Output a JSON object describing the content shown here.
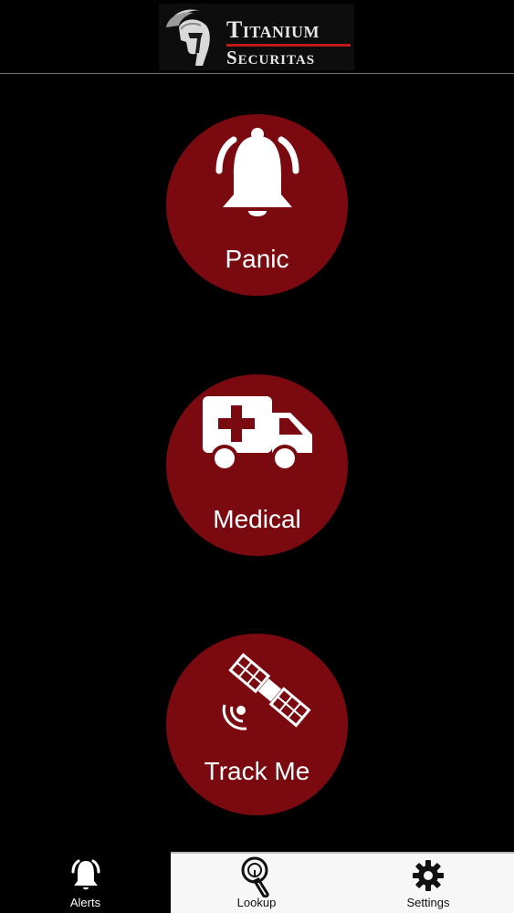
{
  "header": {
    "logo_line1": "Titanium",
    "logo_line2": "Securitas"
  },
  "alerts": {
    "panic_label": "Panic",
    "medical_label": "Medical",
    "trackme_label": "Track Me"
  },
  "tabbar": {
    "alerts_label": "Alerts",
    "lookup_label": "Lookup",
    "settings_label": "Settings",
    "selected": "Alerts"
  },
  "colors": {
    "background": "#000000",
    "button_red": "#7a0a10",
    "logo_accent": "#c21a1a",
    "tabbar_inactive_bg": "#f7f7f7"
  },
  "icons": {
    "logo": "spartan-helmet-icon",
    "panic": "alarm-bell-icon",
    "medical": "ambulance-icon",
    "trackme": "satellite-icon",
    "tab_alerts": "bell-icon",
    "tab_lookup": "fingerprint-icon",
    "tab_settings": "gear-icon"
  }
}
